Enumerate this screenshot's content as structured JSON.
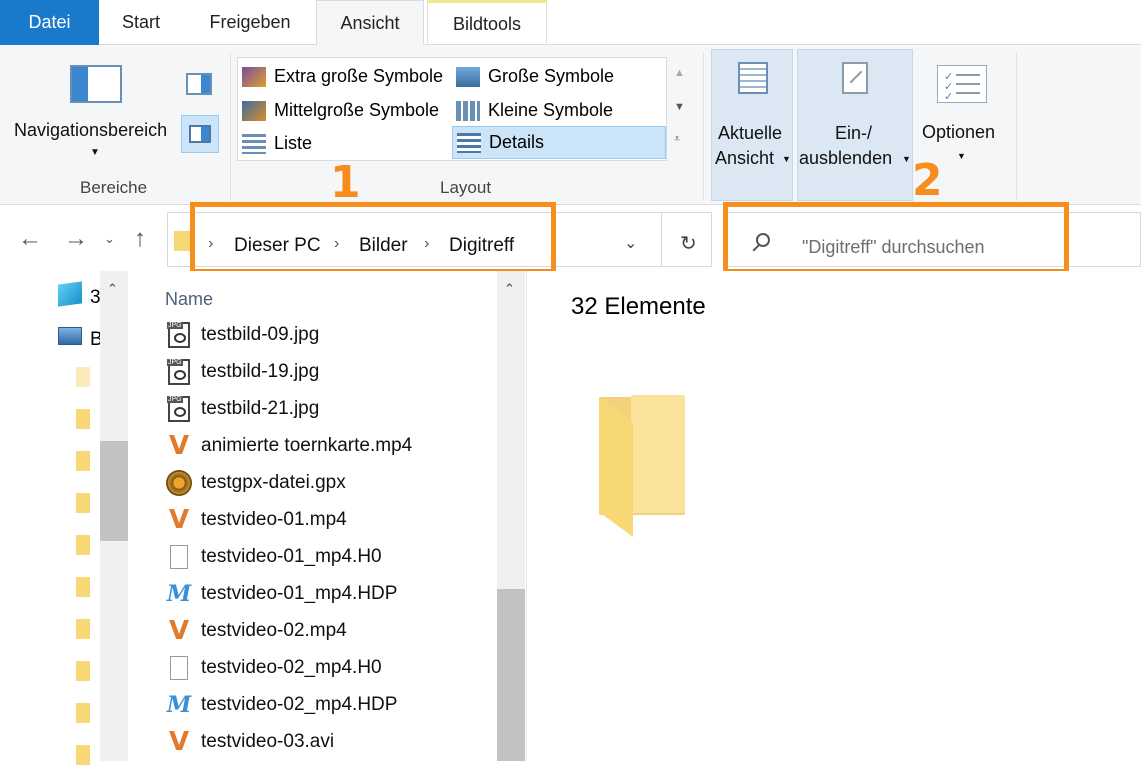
{
  "tabs": {
    "file": "Datei",
    "start": "Start",
    "share": "Freigeben",
    "view": "Ansicht",
    "tools": "Bildtools"
  },
  "ribbon": {
    "nav_pane_label": "Navigationsbereich",
    "group_panes": "Bereiche",
    "group_layout": "Layout",
    "layout_items": [
      "Extra große Symbole",
      "Große Symbole",
      "Mittelgroße Symbole",
      "Kleine Symbole",
      "Liste",
      "Details"
    ],
    "selected_layout": "Details",
    "current_view": [
      "Aktuelle",
      "Ansicht"
    ],
    "show_hide": [
      "Ein-/",
      "ausblenden"
    ],
    "options": "Optionen"
  },
  "address": {
    "crumbs": [
      "Dieser PC",
      "Bilder",
      "Digitreff"
    ]
  },
  "search": {
    "placeholder": "\"Digitreff\" durchsuchen"
  },
  "markers": {
    "one": "1",
    "two": "2"
  },
  "navpane": {
    "item1_text": "3",
    "item2_text": "B"
  },
  "filelist": {
    "header": "Name",
    "files": [
      {
        "name": "testbild-09.jpg",
        "icon": "jpg-file-icon"
      },
      {
        "name": "testbild-19.jpg",
        "icon": "jpg-file-icon"
      },
      {
        "name": "testbild-21.jpg",
        "icon": "jpg-file-icon"
      },
      {
        "name": "animierte toernkarte.mp4",
        "icon": "video-file-icon"
      },
      {
        "name": "testgpx-datei.gpx",
        "icon": "gpx-file-icon"
      },
      {
        "name": "testvideo-01.mp4",
        "icon": "video-file-icon"
      },
      {
        "name": "testvideo-01_mp4.H0",
        "icon": "blank-file-icon"
      },
      {
        "name": "testvideo-01_mp4.HDP",
        "icon": "hdp-file-icon"
      },
      {
        "name": "testvideo-02.mp4",
        "icon": "video-file-icon"
      },
      {
        "name": "testvideo-02_mp4.H0",
        "icon": "blank-file-icon"
      },
      {
        "name": "testvideo-02_mp4.HDP",
        "icon": "hdp-file-icon"
      },
      {
        "name": "testvideo-03.avi",
        "icon": "video-file-icon"
      }
    ]
  },
  "preview": {
    "count": "32 Elemente"
  },
  "colors": {
    "accent": "#1979ca",
    "highlight": "#f68d1d",
    "folder": "#f8d775",
    "selection": "#cce4f7"
  }
}
